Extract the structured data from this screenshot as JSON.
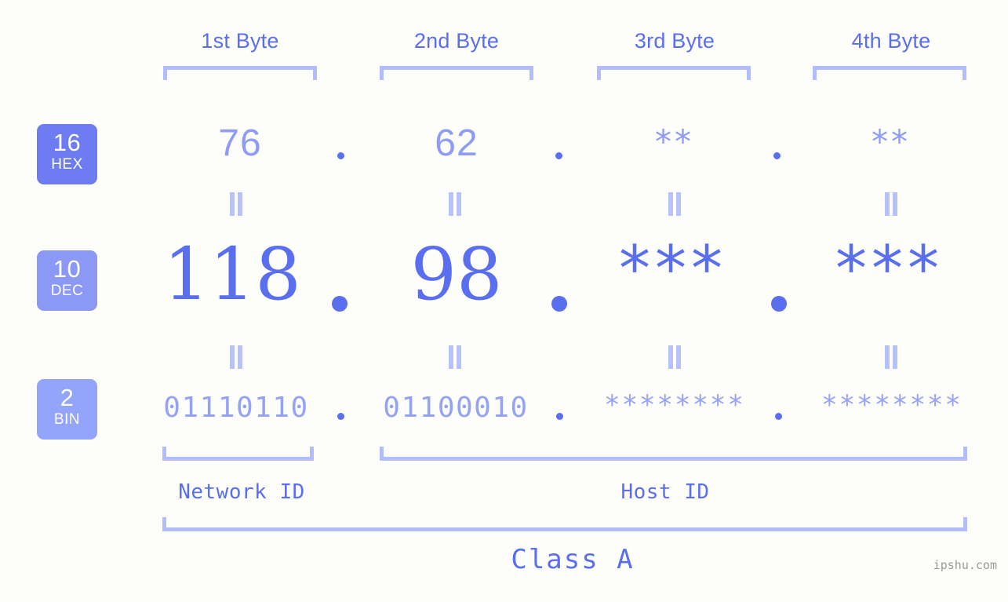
{
  "meta": {
    "background": "#fdfdfa",
    "accent_strong": "#5a6ef0",
    "accent_mid": "#8e9cf5",
    "accent_light": "#b3bdfb",
    "watermark": "ipshu.com"
  },
  "headers": [
    {
      "label": "1st Byte"
    },
    {
      "label": "2nd Byte"
    },
    {
      "label": "3rd Byte"
    },
    {
      "label": "4th Byte"
    }
  ],
  "bases": [
    {
      "num": "16",
      "name": "HEX",
      "color": "#6d7cf0"
    },
    {
      "num": "10",
      "name": "DEC",
      "color": "#8b98f4"
    },
    {
      "num": "2",
      "name": "BIN",
      "color": "#93a4fb"
    }
  ],
  "rows": {
    "hex": {
      "values": [
        "76",
        "62",
        "**",
        "**"
      ],
      "separators": [
        ".",
        ".",
        "."
      ]
    },
    "dec": {
      "values": [
        "118",
        "98",
        "***",
        "***"
      ],
      "separators": [
        ".",
        ".",
        "."
      ]
    },
    "bin": {
      "values": [
        "01110110",
        "01100010",
        "********",
        "********"
      ],
      "separators": [
        ".",
        ".",
        "."
      ]
    }
  },
  "equals": {
    "glyph": "=",
    "count": 8
  },
  "sections": [
    {
      "label": "Network ID"
    },
    {
      "label": "Host ID"
    }
  ],
  "class": {
    "label": "Class A"
  }
}
